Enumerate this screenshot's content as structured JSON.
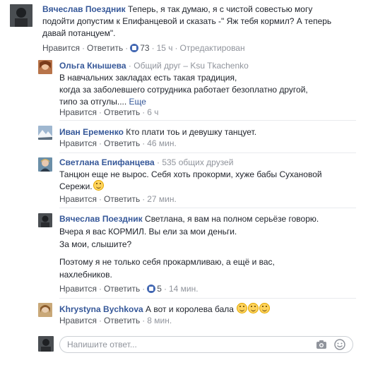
{
  "comments": [
    {
      "name": "Вячеслав Поездник",
      "lines": [
        " Теперь, я так думаю, я с чистой совестью могу",
        "подойти допустим к Епифанцевой и сказать -\" Яж тебя кормил? А теперь",
        "давай потанцуем\"."
      ],
      "like": "Нравится",
      "reply": "Ответить",
      "reactions": "73",
      "time": "15 ч",
      "edited": "Отредактирован"
    },
    {
      "name": "Ольга Кнышева",
      "meta": " · Общий друг – Ksu Tkachenko",
      "lines": [
        "В навчальних закладах есть такая традиция,",
        "когда за заболевшего сотрудника работает безоплатно другой,",
        "типо за отгулы.... "
      ],
      "more": "Еще",
      "like": "Нравится",
      "reply": "Ответить",
      "time": "6 ч"
    },
    {
      "name": "Иван Еременко",
      "lines": [
        " Кто плати тоь и девушку танцует."
      ],
      "like": "Нравится",
      "reply": "Ответить",
      "time": "46 мин."
    },
    {
      "name": "Светлана Епифанцева",
      "meta": " · 535 общих друзей",
      "lines": [
        "Танцюн еще не вырос. Себя хоть прокорми, хуже бабы Сухановой",
        "Сережи."
      ],
      "like": "Нравится",
      "reply": "Ответить",
      "time": "27 мин."
    },
    {
      "name": "Вячеслав Поездник",
      "lines": [
        " Светлана, я вам на полном серьёзе говорю.",
        "Вчера я вас КОРМИЛ. Вы ели за мои деньги.",
        "За мои, слышите?",
        "",
        "Поэтому я не только себя прокармливаю, а ещё и вас,",
        "нахлебников."
      ],
      "like": "Нравится",
      "reply": "Ответить",
      "reactions": "5",
      "time": "14 мин."
    },
    {
      "name": "Khrystyna Bychkova",
      "lines": [
        " А вот и королева бала "
      ],
      "like": "Нравится",
      "reply": "Ответить",
      "time": "8 мин."
    }
  ],
  "reply_box": {
    "placeholder": "Напишите ответ..."
  },
  "icons": {
    "camera": "camera-icon",
    "sticker": "smiley-sticker-icon"
  },
  "colors": {
    "link": "#365899",
    "muted": "#90949c",
    "like_blue": "#4267b2",
    "emoji_yellow": "#ffd35c"
  }
}
